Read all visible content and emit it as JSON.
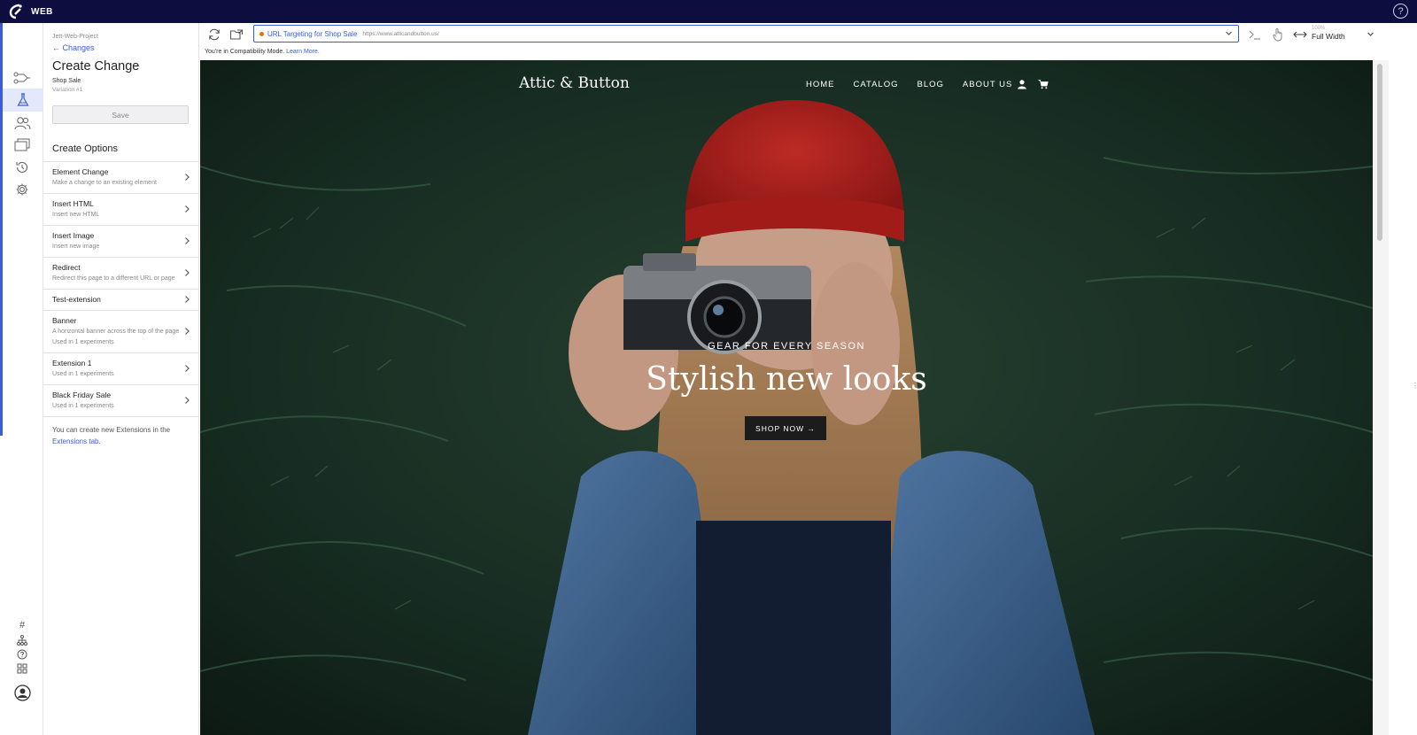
{
  "app": {
    "title": "WEB",
    "help_icon": "question-circle-icon",
    "help_glyph": "?"
  },
  "rail": {
    "icons": [
      "flow-icon",
      "flask-icon",
      "users-icon",
      "layers-icon",
      "history-icon",
      "gear-icon"
    ],
    "bottom_icons": [
      "hash-icon",
      "sitemap-icon",
      "help-icon",
      "extensions-icon",
      "user-avatar-icon"
    ],
    "hash_glyph": "#"
  },
  "panel": {
    "project": "Jett-Web-Project",
    "back_label": "← Changes",
    "title": "Create Change",
    "campaign": "Shop Sale",
    "variation": "Variation #1",
    "save_label": "Save",
    "section_title": "Create Options",
    "options": [
      {
        "label": "Element Change",
        "desc": "Make a change to an existing element",
        "usage": ""
      },
      {
        "label": "Insert HTML",
        "desc": "Insert new HTML",
        "usage": ""
      },
      {
        "label": "Insert Image",
        "desc": "Insert new image",
        "usage": ""
      },
      {
        "label": "Redirect",
        "desc": "Redirect this page to a different URL or page",
        "usage": ""
      },
      {
        "label": "Test-extension",
        "desc": "",
        "usage": ""
      },
      {
        "label": "Banner",
        "desc": "A horizontal banner across the top of the page",
        "usage": "Used in 1 experiments"
      },
      {
        "label": "Extension 1",
        "desc": "",
        "usage": "Used in 1 experiments"
      },
      {
        "label": "Black Friday Sale",
        "desc": "",
        "usage": "Used in 1 experiments"
      }
    ],
    "note_text": "You can create new Extensions in the ",
    "note_link": "Extensions tab."
  },
  "toolbar": {
    "url_label": "URL Targeting for Shop Sale",
    "url": "https://www.atticandbutton.us/",
    "zoom_percent": "100%",
    "width_mode": "Full Width"
  },
  "compat": {
    "text": "You're in Compatibility Mode. ",
    "link": "Learn More."
  },
  "site": {
    "logo": "Attic & Button",
    "nav": [
      "HOME",
      "CATALOG",
      "BLOG",
      "ABOUT US"
    ],
    "kicker": "GEAR FOR EVERY SEASON",
    "headline": "Stylish new looks",
    "cta": "SHOP NOW →"
  }
}
